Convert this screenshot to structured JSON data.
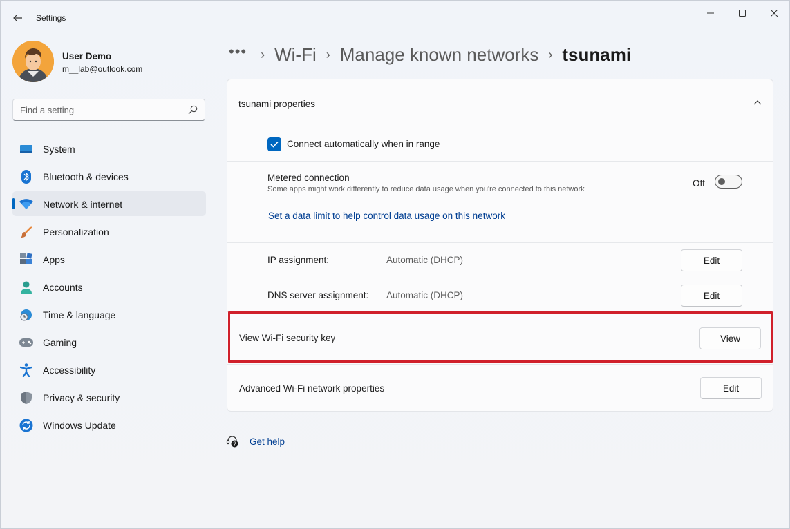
{
  "window": {
    "title": "Settings"
  },
  "profile": {
    "name": "User Demo",
    "email": "m__lab@outlook.com"
  },
  "search": {
    "placeholder": "Find a setting"
  },
  "sidebar": {
    "items": [
      {
        "label": "System",
        "icon": "system-icon"
      },
      {
        "label": "Bluetooth & devices",
        "icon": "bluetooth-icon"
      },
      {
        "label": "Network & internet",
        "icon": "wifi-icon",
        "active": true
      },
      {
        "label": "Personalization",
        "icon": "brush-icon"
      },
      {
        "label": "Apps",
        "icon": "apps-icon"
      },
      {
        "label": "Accounts",
        "icon": "person-icon"
      },
      {
        "label": "Time & language",
        "icon": "globe-clock-icon"
      },
      {
        "label": "Gaming",
        "icon": "gamepad-icon"
      },
      {
        "label": "Accessibility",
        "icon": "accessibility-icon"
      },
      {
        "label": "Privacy & security",
        "icon": "shield-icon"
      },
      {
        "label": "Windows Update",
        "icon": "update-icon"
      }
    ]
  },
  "breadcrumb": {
    "more": "•••",
    "items": [
      "Wi-Fi",
      "Manage known networks"
    ],
    "current": "tsunami"
  },
  "card": {
    "title": "tsunami properties",
    "auto_connect": {
      "label": "Connect automatically when in range",
      "checked": true
    },
    "metered": {
      "title": "Metered connection",
      "description": "Some apps might work differently to reduce data usage when you're connected to this network",
      "state_label": "Off",
      "link": "Set a data limit to help control data usage on this network"
    },
    "ip": {
      "label": "IP assignment:",
      "value": "Automatic (DHCP)",
      "button": "Edit"
    },
    "dns": {
      "label": "DNS server assignment:",
      "value": "Automatic (DHCP)",
      "button": "Edit"
    },
    "security_key": {
      "label": "View Wi-Fi security key",
      "button": "View"
    },
    "advanced": {
      "label": "Advanced Wi-Fi network properties",
      "button": "Edit"
    }
  },
  "help": {
    "label": "Get help"
  },
  "colors": {
    "accent": "#0067c0",
    "highlight": "#d0202b",
    "link": "#003e92"
  }
}
